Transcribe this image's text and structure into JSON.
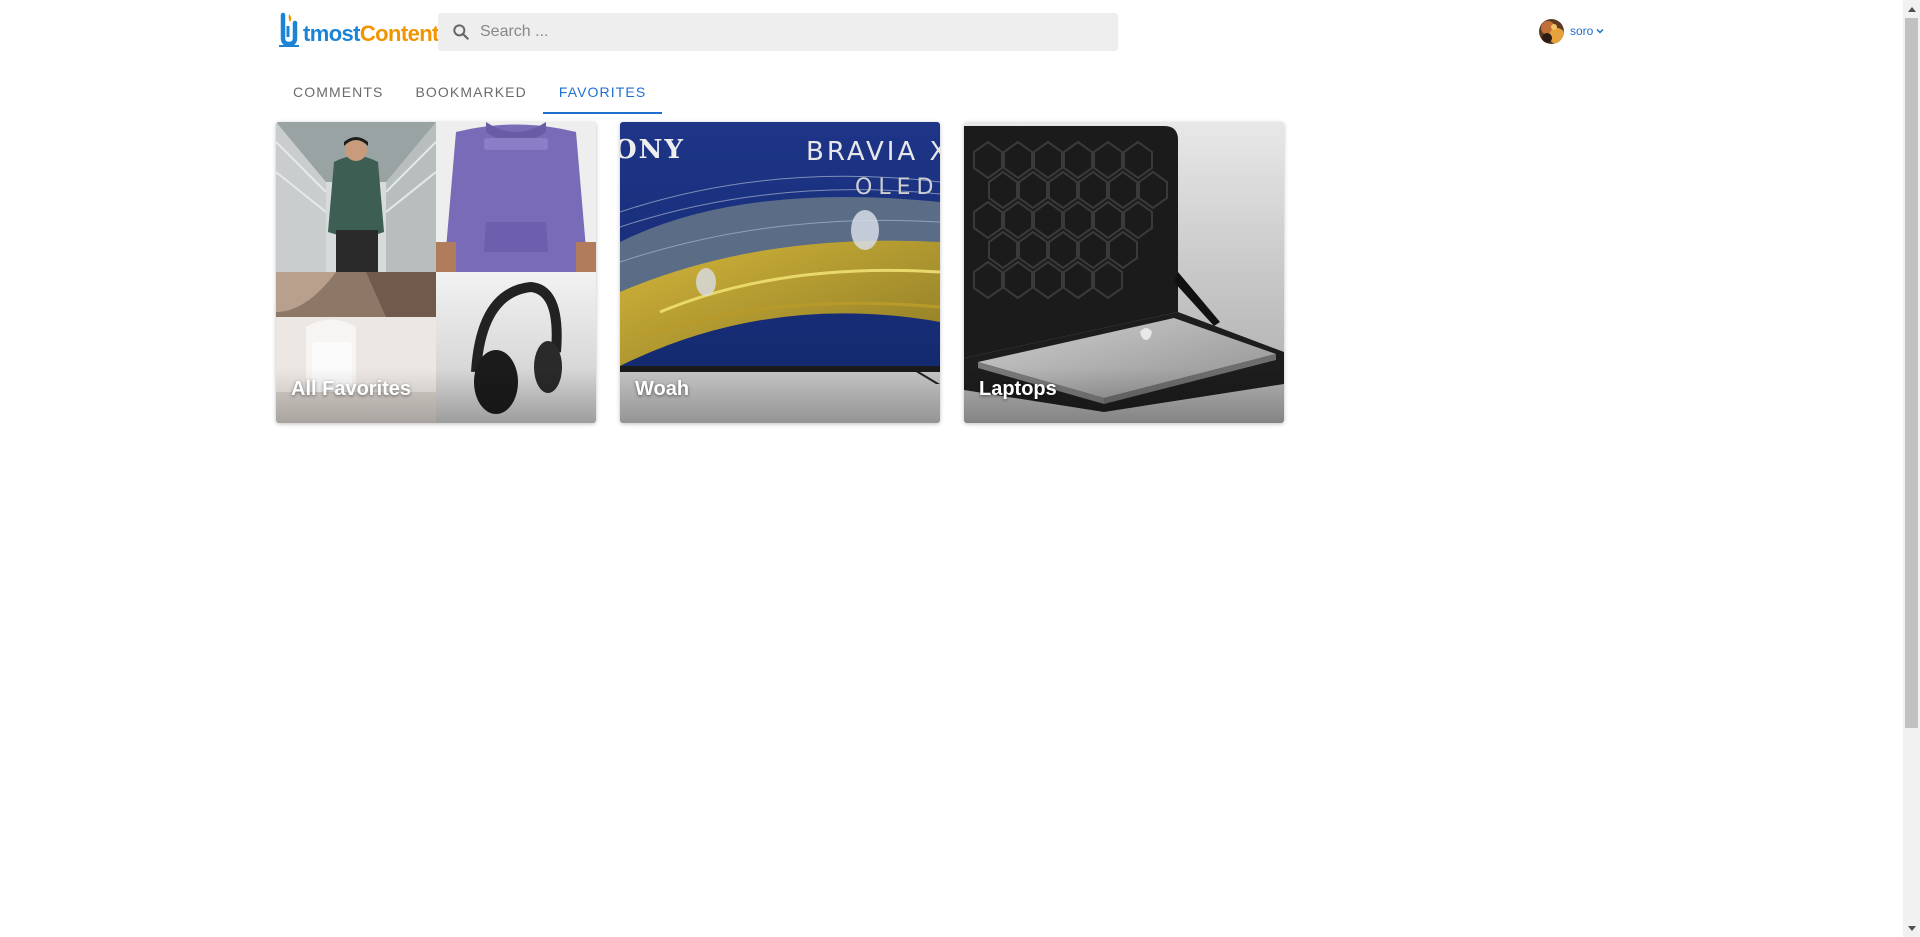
{
  "header": {
    "logo": {
      "part1": "tmost",
      "part2": "Content",
      "alt": "UtmostContent"
    },
    "search": {
      "placeholder": "Search ...",
      "value": ""
    },
    "user": {
      "name": "soro"
    }
  },
  "tabs": [
    {
      "label": "COMMENTS",
      "active": false
    },
    {
      "label": "BOOKMARKED",
      "active": false
    },
    {
      "label": "FAVORITES",
      "active": true
    }
  ],
  "favorites": [
    {
      "title": "All Favorites",
      "images": [
        "green-hoodie-photo",
        "purple-champion-hoodie-photo",
        "white-speaker-photo",
        "black-headphones-photo"
      ]
    },
    {
      "title": "Woah",
      "images": [
        "sony-bravia-xr-oled-tv-photo"
      ]
    },
    {
      "title": "Laptops",
      "images": [
        "laptop-sleeve-photo"
      ]
    }
  ],
  "colors": {
    "accent": "#1e6fd0",
    "logo_blue": "#1c84d6",
    "logo_orange": "#f29400",
    "search_bg": "#eeeeee",
    "tab_inactive": "#6b6b6b"
  },
  "icons": {
    "search": "search-icon",
    "chevron": "chevron-down-icon",
    "logo": "utmost-logo-icon"
  }
}
